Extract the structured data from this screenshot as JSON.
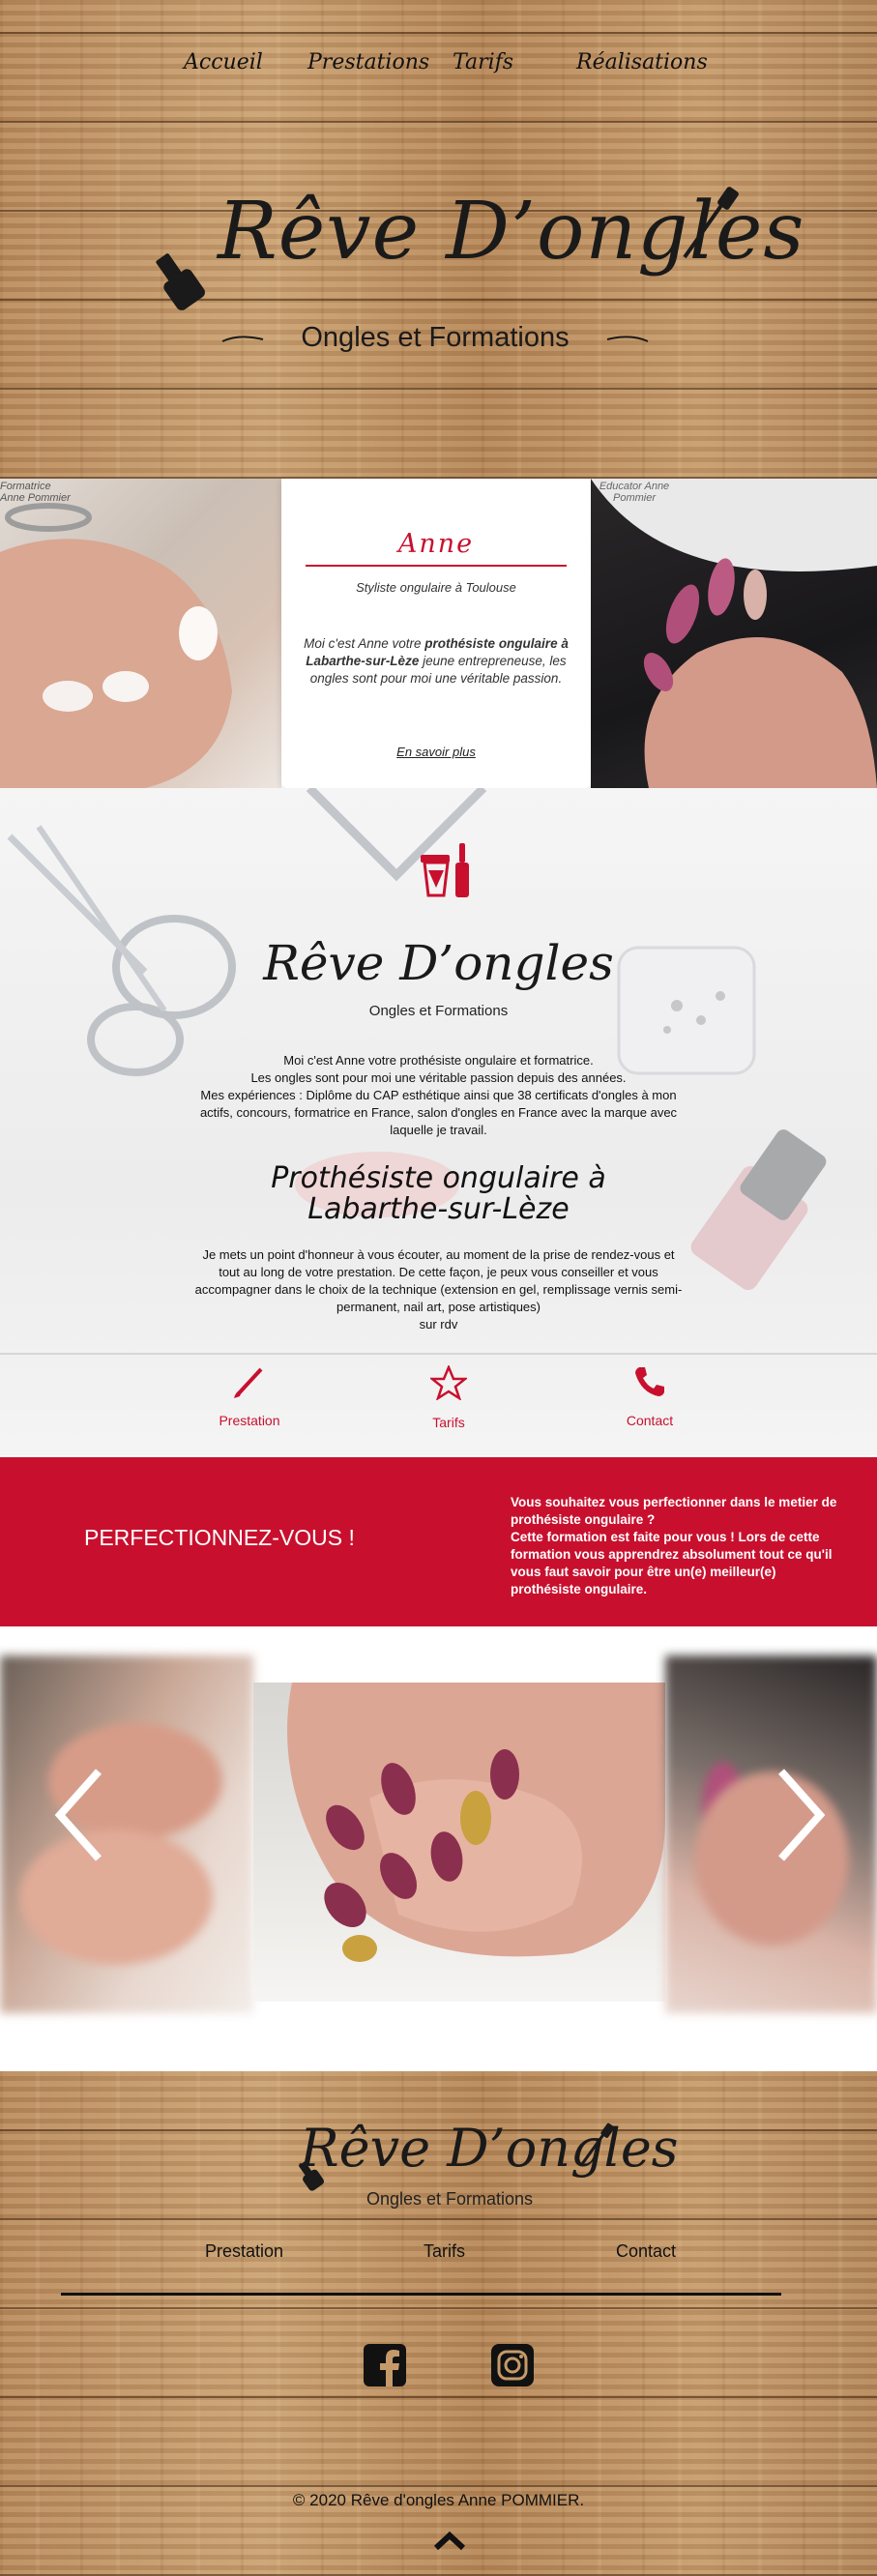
{
  "nav": {
    "items": [
      "Accueil",
      "Prestations",
      "Tarifs",
      "Réalisations"
    ]
  },
  "brand": {
    "name": "Rêve D’ongles",
    "tagline": "Ongles et Formations"
  },
  "anne": {
    "name": "Anne",
    "role": "Styliste ongulaire à Toulouse",
    "intro_start": "Moi c'est Anne votre ",
    "intro_bold1": "prothésiste ongulaire à Labarthe-sur-Lèze",
    "intro_end": " jeune entrepreneuse, les ongles sont pour moi une véritable passion.",
    "more_link": "En savoir plus",
    "photo_left_caption": "Formatrice Anne Pommier",
    "photo_right_caption": "Educator Anne Pommier"
  },
  "about": {
    "paragraph": "Moi c'est Anne votre prothésiste ongulaire et formatrice.\nLes ongles sont pour moi une véritable passion depuis des années.\nMes expériences : Diplôme du CAP esthétique ainsi que 38 certificats d'ongles à mon actifs, concours, formatrice en France, salon d'ongles en France avec la marque avec laquelle je travail.",
    "heading_line1": "Prothésiste ongulaire à",
    "heading_line2": "Labarthe-sur-Lèze",
    "service_text": "Je mets un point d'honneur à vous écouter, au moment de la prise de rendez-vous et tout au long de votre prestation. De cette façon, je peux vous conseiller et vous accompagner dans le choix de la technique (extension en gel, remplissage vernis semi-permanent, nail art, pose artistiques)\nsur rdv"
  },
  "quick_links": [
    {
      "label": "Prestation",
      "icon": "brush-icon"
    },
    {
      "label": "Tarifs",
      "icon": "star-icon"
    },
    {
      "label": "Contact",
      "icon": "phone-icon"
    }
  ],
  "perfect": {
    "title": "PERFECTIONNEZ-VOUS !",
    "text": "Vous souhaitez vous perfectionner dans le metier de prothésiste ongulaire ?\nCette formation est faite pour vous ! Lors de cette formation vous apprendrez absolument tout ce qu'il vous faut savoir pour être un(e) meilleur(e) prothésiste ongulaire."
  },
  "footer": {
    "links": [
      "Prestation",
      "Tarifs",
      "Contact"
    ],
    "social": [
      "facebook-icon",
      "instagram-icon"
    ],
    "copyright": "© 2020 Rêve d'ongles Anne POMMIER."
  },
  "colors": {
    "accent": "#c8102e",
    "wood": "#b98b5e"
  }
}
